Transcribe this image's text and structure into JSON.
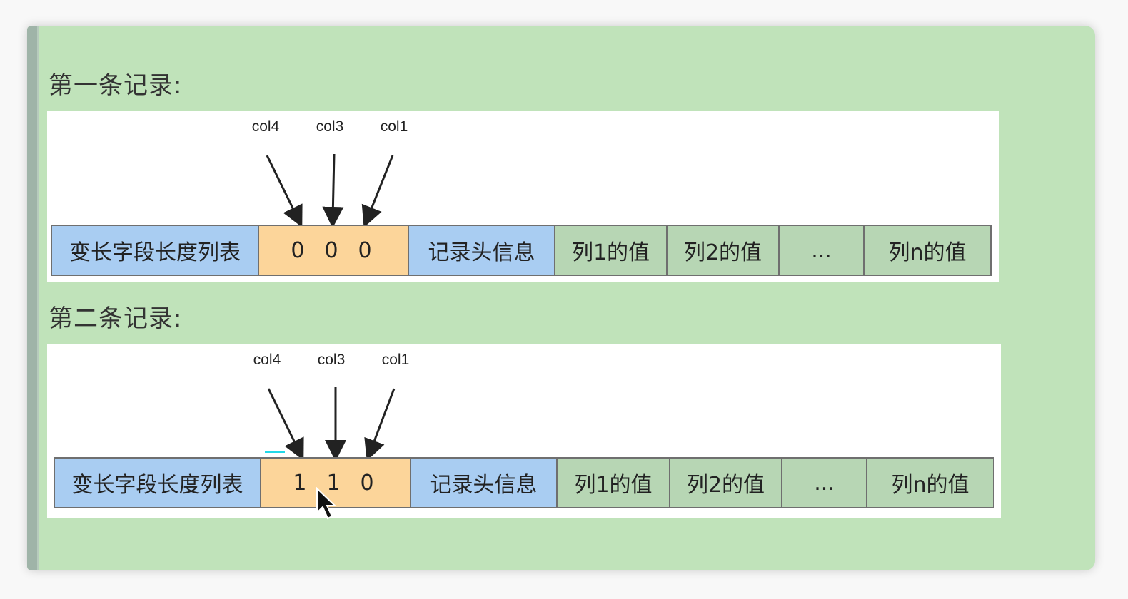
{
  "records": [
    {
      "heading": "第一条记录:",
      "col_labels": [
        "col4",
        "col3",
        "col1"
      ],
      "null_flags": [
        "0",
        "0",
        "0"
      ],
      "cells": [
        "变长字段长度列表",
        "记录头信息",
        "列1的值",
        "列2的值",
        "...",
        "列n的值"
      ]
    },
    {
      "heading": "第二条记录:",
      "col_labels": [
        "col4",
        "col3",
        "col1"
      ],
      "null_flags": [
        "1",
        "1",
        "0"
      ],
      "cells": [
        "变长字段长度列表",
        "记录头信息",
        "列1的值",
        "列2的值",
        "...",
        "列n的值"
      ]
    }
  ],
  "colors": {
    "panel_background": "#c0e3ba",
    "blue_cell": "#a9cdf2",
    "orange_cell": "#fcd59a",
    "green_cell": "#b7d6b4"
  }
}
